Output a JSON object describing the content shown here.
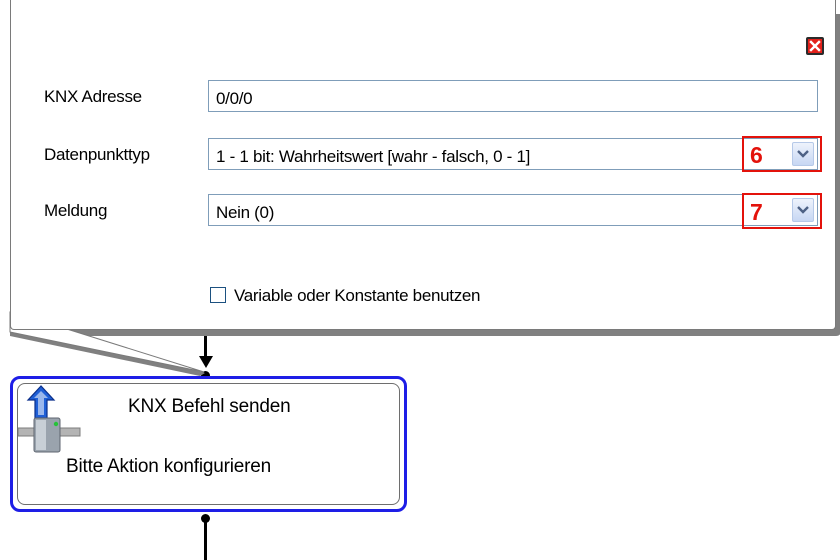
{
  "dialog": {
    "fields": [
      {
        "label": "KNX Adresse",
        "value": "0/0/0"
      },
      {
        "label": "Datenpunkttyp",
        "value": "1 - 1 bit: Wahrheitswert [wahr - falsch, 0 - 1]",
        "marker": "6"
      },
      {
        "label": "Meldung",
        "value": "Nein (0)",
        "marker": "7"
      }
    ],
    "checkbox_label": "Variable oder Konstante benutzen",
    "checkbox_checked": false,
    "close_icon": "close-icon"
  },
  "node": {
    "title": "KNX Befehl senden",
    "subtitle": "Bitte Aktion konfigurieren",
    "icon": "knx-send-icon"
  },
  "colors": {
    "marker": "#e3120b",
    "node_border": "#1e1ee6",
    "close_button": "#e3211b"
  }
}
